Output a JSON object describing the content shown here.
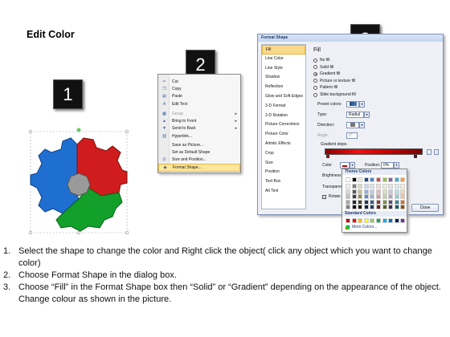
{
  "page": {
    "title": "Edit Color"
  },
  "badges": [
    "1",
    "2",
    "3"
  ],
  "gear_colors": {
    "blue": "#1f6fd1",
    "red": "#d01c1c",
    "green": "#12a02a",
    "hub": "#9a9a9a"
  },
  "context_menu": {
    "items": [
      {
        "label": "Cut",
        "icon": "scissors-icon",
        "disabled": false,
        "submenu": false
      },
      {
        "label": "Copy",
        "icon": "copy-icon",
        "disabled": false,
        "submenu": false
      },
      {
        "label": "Paste",
        "icon": "paste-icon",
        "disabled": false,
        "submenu": false
      },
      {
        "label": "Edit Text",
        "icon": "text-icon",
        "disabled": false,
        "submenu": false
      },
      {
        "label": "Group",
        "icon": "group-icon",
        "disabled": true,
        "submenu": true
      },
      {
        "label": "Bring to Front",
        "icon": "bring-front-icon",
        "disabled": false,
        "submenu": true
      },
      {
        "label": "Send to Back",
        "icon": "send-back-icon",
        "disabled": false,
        "submenu": true
      },
      {
        "label": "Hyperlink...",
        "icon": "hyperlink-icon",
        "disabled": false,
        "submenu": false
      },
      {
        "label": "Save as Picture...",
        "icon": "",
        "disabled": false,
        "submenu": false
      },
      {
        "label": "Set as Default Shape",
        "icon": "",
        "disabled": false,
        "submenu": false
      },
      {
        "label": "Size and Position...",
        "icon": "size-icon",
        "disabled": false,
        "submenu": false
      },
      {
        "label": "Format Shape...",
        "icon": "format-shape-icon",
        "disabled": false,
        "submenu": false,
        "highlight": true
      }
    ]
  },
  "dialog": {
    "title": "Format Shape",
    "nav": [
      "Fill",
      "Line Color",
      "Line Style",
      "Shadow",
      "Reflection",
      "Glow and Soft Edges",
      "3-D Format",
      "3-D Rotation",
      "Picture Corrections",
      "Picture Color",
      "Artistic Effects",
      "Crop",
      "Size",
      "Position",
      "Text Box",
      "Alt Text"
    ],
    "selected_nav": "Fill",
    "fill_heading": "Fill",
    "fill_options": [
      {
        "label": "No fill",
        "selected": false
      },
      {
        "label": "Solid fill",
        "selected": false
      },
      {
        "label": "Gradient fill",
        "selected": true
      },
      {
        "label": "Picture or texture fill",
        "selected": false
      },
      {
        "label": "Pattern fill",
        "selected": false
      },
      {
        "label": "Slide background fill",
        "selected": false
      }
    ],
    "preset_label": "Preset colors:",
    "type_label": "Type:",
    "type_value": "Radial",
    "direction_label": "Direction:",
    "angle_label": "Angle:",
    "angle_value": "0°",
    "gradient_stops_label": "Gradient stops",
    "color_label": "Color",
    "position_label": "Position:",
    "position_value": "0%",
    "brightness_label": "Brightness",
    "transparency_label": "Transparen",
    "rotate_label": "Rotate",
    "close_label": "Close"
  },
  "color_popup": {
    "theme_label": "Theme Colors",
    "standard_label": "Standard Colors",
    "more_label": "More Colors...",
    "theme_top": [
      "#ffffff",
      "#000000",
      "#eeece1",
      "#1f497d",
      "#4f81bd",
      "#c0504d",
      "#9bbb59",
      "#8064a2",
      "#4bacc6",
      "#f79646"
    ],
    "theme_cols": [
      [
        "#f2f2f2",
        "#d9d9d9",
        "#bfbfbf",
        "#a6a6a6",
        "#808080"
      ],
      [
        "#7f7f7f",
        "#595959",
        "#404040",
        "#262626",
        "#0d0d0d"
      ],
      [
        "#ddd9c3",
        "#c4bd97",
        "#948a54",
        "#4a452a",
        "#1d1b10"
      ],
      [
        "#c6d9f0",
        "#8db3e2",
        "#548dd4",
        "#17365d",
        "#0f243e"
      ],
      [
        "#dbe5f1",
        "#b8cce4",
        "#95b3d7",
        "#366092",
        "#244061"
      ],
      [
        "#f2dcdb",
        "#e5b9b7",
        "#d99694",
        "#953734",
        "#632423"
      ],
      [
        "#ebf1dd",
        "#d7e3bc",
        "#c3d69b",
        "#76923c",
        "#4f6128"
      ],
      [
        "#e5e0ec",
        "#ccc1d9",
        "#b2a2c7",
        "#5f497a",
        "#3f3151"
      ],
      [
        "#dbeef3",
        "#b7dde8",
        "#92cddc",
        "#31859b",
        "#205867"
      ],
      [
        "#fdeada",
        "#fbd5b5",
        "#fac08f",
        "#e36c09",
        "#974806"
      ]
    ],
    "standard": [
      "#c00000",
      "#ff0000",
      "#ffc000",
      "#ffff00",
      "#92d050",
      "#00b050",
      "#00b0f0",
      "#0070c0",
      "#002060",
      "#7030a0"
    ]
  },
  "instructions": [
    {
      "num": "1.",
      "text": "Select the shape to change the color and Right click the object( click any object which you want to change color)"
    },
    {
      "num": "2.",
      "text": "Choose Format Shape in the dialog box."
    },
    {
      "num": "3.",
      "text": "Choose “Fill” in the Format Shape box then “Solid” or “Gradient” depending on the appearance of the object. Change colour as shown in the picture."
    }
  ]
}
